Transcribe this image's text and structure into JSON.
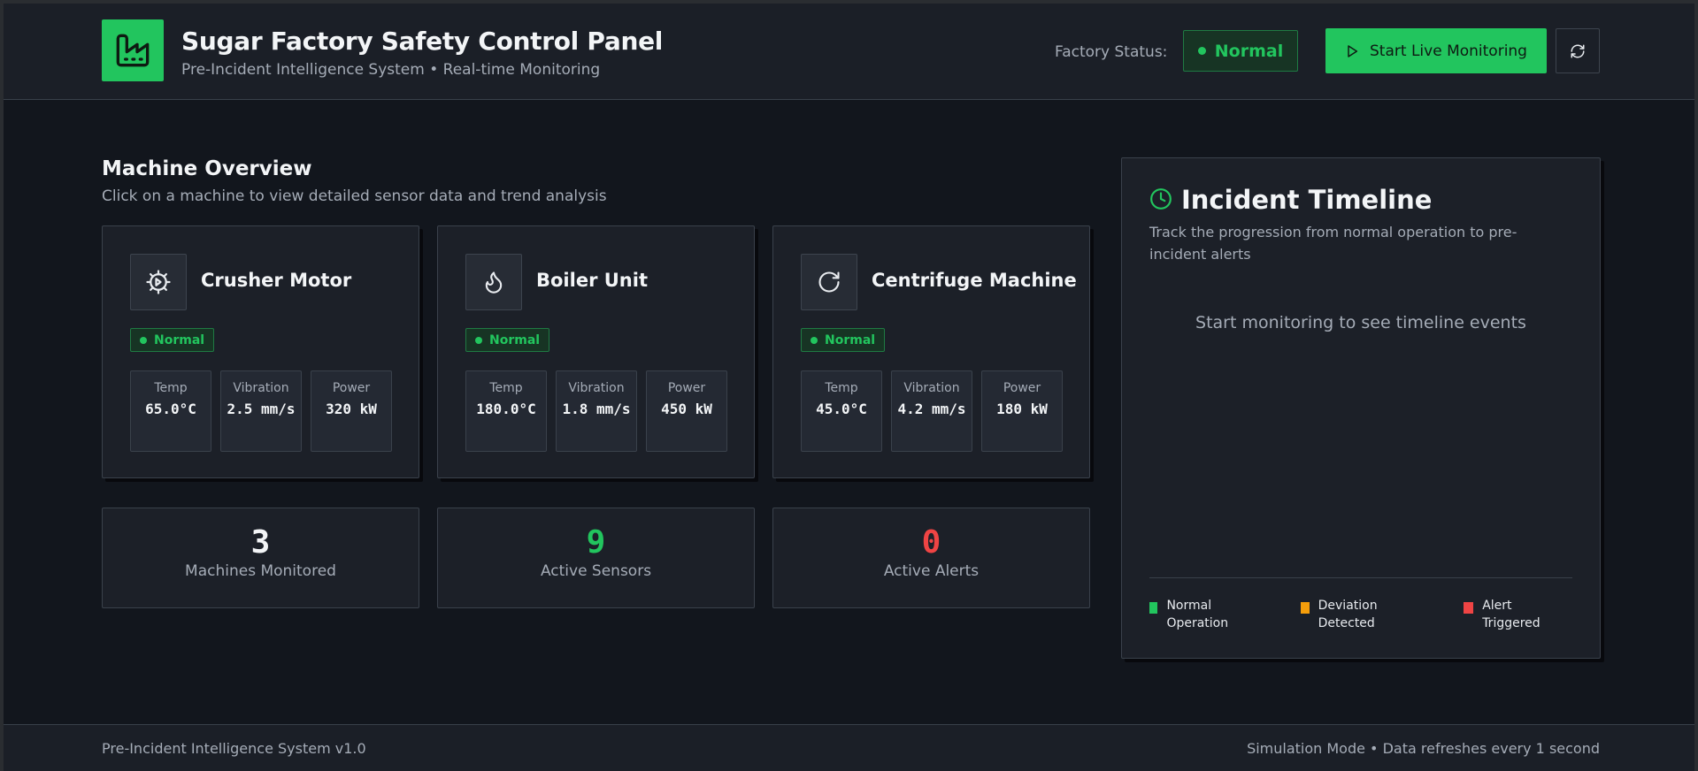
{
  "header": {
    "title": "Sugar Factory Safety Control Panel",
    "subtitle": "Pre-Incident Intelligence System • Real-time Monitoring",
    "logo_icon": "factory-icon",
    "status_label": "Factory Status:",
    "status_value": "Normal",
    "start_button_label": "Start Live Monitoring",
    "start_button_icon": "play-icon",
    "refresh_icon": "refresh-icon"
  },
  "overview": {
    "title": "Machine Overview",
    "subtitle": "Click on a machine to view detailed sensor data and trend analysis"
  },
  "machines": [
    {
      "name": "Crusher Motor",
      "icon": "gear-icon",
      "status": "Normal",
      "metrics": [
        {
          "label": "Temp",
          "value": "65.0°C"
        },
        {
          "label": "Vibration",
          "value": "2.5 mm/s"
        },
        {
          "label": "Power",
          "value": "320 kW"
        }
      ]
    },
    {
      "name": "Boiler Unit",
      "icon": "flame-icon",
      "status": "Normal",
      "metrics": [
        {
          "label": "Temp",
          "value": "180.0°C"
        },
        {
          "label": "Vibration",
          "value": "1.8 mm/s"
        },
        {
          "label": "Power",
          "value": "450 kW"
        }
      ]
    },
    {
      "name": "Centrifuge Machine",
      "icon": "rotate-icon",
      "status": "Normal",
      "metrics": [
        {
          "label": "Temp",
          "value": "45.0°C"
        },
        {
          "label": "Vibration",
          "value": "4.2 mm/s"
        },
        {
          "label": "Power",
          "value": "180 kW"
        }
      ]
    }
  ],
  "stats": [
    {
      "value": "3",
      "label": "Machines Monitored",
      "color": "#f3f5f7"
    },
    {
      "value": "9",
      "label": "Active Sensors",
      "color": "#22c55e"
    },
    {
      "value": "0",
      "label": "Active Alerts",
      "color": "#ef4444"
    }
  ],
  "timeline": {
    "title": "Incident Timeline",
    "icon": "clock-icon",
    "subtitle": "Track the progression from normal operation to pre-incident alerts",
    "empty_message": "Start monitoring to see timeline events",
    "legend": [
      {
        "label": "Normal Operation",
        "color": "#22c55e"
      },
      {
        "label": "Deviation Detected",
        "color": "#f59e0b"
      },
      {
        "label": "Alert Triggered",
        "color": "#ef4444"
      }
    ]
  },
  "footer": {
    "left": "Pre-Incident Intelligence System v1.0",
    "right": "Simulation Mode • Data refreshes every 1 second"
  },
  "colors": {
    "accent": "#22c55e",
    "warning": "#f59e0b",
    "danger": "#ef4444",
    "background": "#12161d"
  }
}
